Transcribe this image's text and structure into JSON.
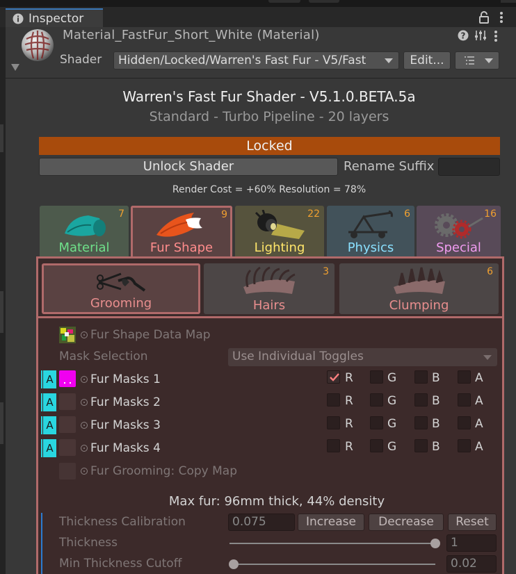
{
  "inspector": {
    "tab_label": "Inspector"
  },
  "material": {
    "title": "Material_FastFur_Short_White (Material)",
    "shader_label": "Shader",
    "shader_value": "Hidden/Locked/Warren's Fast Fur - V5/Fast",
    "edit_label": "Edit..."
  },
  "header": {
    "title": "Warren's Fast Fur Shader - V5.1.0.BETA.5a",
    "subtitle": "Standard - Turbo Pipeline - 20 layers",
    "locked": "Locked",
    "unlock_label": "Unlock Shader",
    "rename_label": "Rename Suffix",
    "rename_value": "",
    "render_cost": "Render Cost = +60%   Resolution = 78%"
  },
  "categories": [
    {
      "name": "Material",
      "count": "7",
      "color": "#6fe08a"
    },
    {
      "name": "Fur Shape",
      "count": "9",
      "color": "#ff8c8c"
    },
    {
      "name": "Lighting",
      "count": "22",
      "color": "#ffe66a"
    },
    {
      "name": "Physics",
      "count": "6",
      "color": "#8ae0ff"
    },
    {
      "name": "Special",
      "count": "16",
      "color": "#f09cf0"
    }
  ],
  "subcategories": [
    {
      "name": "Grooming",
      "count": ""
    },
    {
      "name": "Hairs",
      "count": "3"
    },
    {
      "name": "Clumping",
      "count": "6"
    }
  ],
  "grooming": {
    "data_map_label": "Fur Shape Data Map",
    "mask_selection_label": "Mask Selection",
    "mask_selection_value": "Use Individual Toggles",
    "badge": "A",
    "masks": [
      {
        "label": "Fur Masks 1",
        "r": true,
        "g": false,
        "b": false,
        "a": false
      },
      {
        "label": "Fur Masks 2",
        "r": false,
        "g": false,
        "b": false,
        "a": false
      },
      {
        "label": "Fur Masks 3",
        "r": false,
        "g": false,
        "b": false,
        "a": false
      },
      {
        "label": "Fur Masks 4",
        "r": false,
        "g": false,
        "b": false,
        "a": false
      }
    ],
    "channels": [
      "R",
      "G",
      "B",
      "A"
    ],
    "copy_map_label": "Fur Grooming: Copy Map",
    "max_fur": "Max fur: 96mm thick, 44% density",
    "thickness_calibration_label": "Thickness Calibration",
    "thickness_calibration_value": "0.075",
    "increase_label": "Increase",
    "decrease_label": "Decrease",
    "reset_label": "Reset",
    "thickness_label": "Thickness",
    "thickness_value": "1",
    "thickness_fraction": 1.0,
    "min_cutoff_label": "Min Thickness Cutoff",
    "min_cutoff_value": "0.02",
    "min_cutoff_fraction": 0.02
  }
}
